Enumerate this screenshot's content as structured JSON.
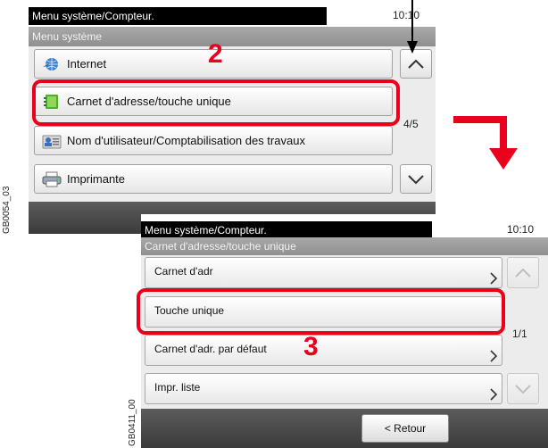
{
  "figure_codes": {
    "screen1": "GB0054_03",
    "screen2": "GB0411_00"
  },
  "screen1": {
    "status_title": "Menu système/Compteur.",
    "time": "10:10",
    "header": "Menu système",
    "items": [
      {
        "label": "Internet"
      },
      {
        "label": "Carnet d'adresse/touche unique"
      },
      {
        "label": "Nom d'utilisateur/Comptabilisation des travaux"
      },
      {
        "label": "Imprimante"
      }
    ],
    "page_indicator": "4/5"
  },
  "screen2": {
    "status_title": "Menu système/Compteur.",
    "time": "10:10",
    "header": "Carnet d'adresse/touche unique",
    "items": [
      {
        "label": "Carnet d'adr"
      },
      {
        "label": "Touche unique"
      },
      {
        "label": "Carnet d'adr. par défaut"
      },
      {
        "label": "Impr. liste"
      }
    ],
    "page_indicator": "1/1",
    "back_label": "< Retour"
  },
  "annotations": {
    "step2": "2",
    "step3": "3"
  },
  "colors": {
    "highlight": "#e8001c",
    "header_bar": "#9a9a9a",
    "footer_bar": "#4a4a4a"
  }
}
